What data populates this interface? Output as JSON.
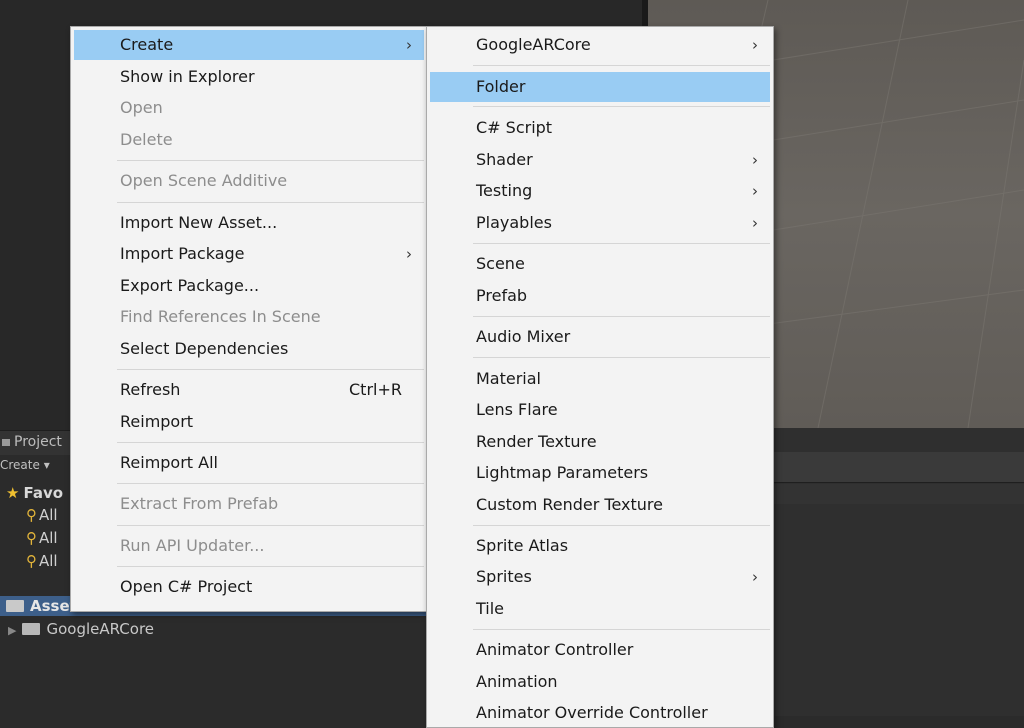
{
  "project_panel": {
    "tab_label": "Project",
    "create_label": "Create ▾",
    "favorites_label": "Favo",
    "search_items": [
      "All",
      "All",
      "All"
    ],
    "assets_label": "Assets",
    "tree_folder": "GoogleARCore"
  },
  "context_menu": {
    "items": [
      {
        "label": "Create",
        "state": "highlighted",
        "submenu": true
      },
      {
        "label": "Show in Explorer",
        "state": "enabled"
      },
      {
        "label": "Open",
        "state": "disabled"
      },
      {
        "label": "Delete",
        "state": "disabled"
      },
      {
        "label": "Open Scene Additive",
        "state": "disabled"
      },
      {
        "label": "Import New Asset...",
        "state": "enabled"
      },
      {
        "label": "Import Package",
        "state": "enabled",
        "submenu": true
      },
      {
        "label": "Export Package...",
        "state": "enabled"
      },
      {
        "label": "Find References In Scene",
        "state": "disabled"
      },
      {
        "label": "Select Dependencies",
        "state": "enabled"
      },
      {
        "label": "Refresh",
        "state": "enabled",
        "shortcut": "Ctrl+R"
      },
      {
        "label": "Reimport",
        "state": "enabled"
      },
      {
        "label": "Reimport All",
        "state": "enabled"
      },
      {
        "label": "Extract From Prefab",
        "state": "disabled"
      },
      {
        "label": "Run API Updater...",
        "state": "disabled"
      },
      {
        "label": "Open C# Project",
        "state": "enabled"
      }
    ]
  },
  "create_submenu": {
    "items": [
      {
        "label": "GoogleARCore",
        "submenu": true
      },
      {
        "label": "Folder",
        "state": "highlighted"
      },
      {
        "label": "C# Script"
      },
      {
        "label": "Shader",
        "submenu": true
      },
      {
        "label": "Testing",
        "submenu": true
      },
      {
        "label": "Playables",
        "submenu": true
      },
      {
        "label": "Scene"
      },
      {
        "label": "Prefab"
      },
      {
        "label": "Audio Mixer"
      },
      {
        "label": "Material"
      },
      {
        "label": "Lens Flare"
      },
      {
        "label": "Render Texture"
      },
      {
        "label": "Lightmap Parameters"
      },
      {
        "label": "Custom Render Texture"
      },
      {
        "label": "Sprite Atlas"
      },
      {
        "label": "Sprites",
        "submenu": true
      },
      {
        "label": "Tile"
      },
      {
        "label": "Animator Controller"
      },
      {
        "label": "Animation"
      },
      {
        "label": "Animator Override Controller"
      }
    ]
  },
  "icons": {
    "submenu_arrow": "chevron-right-icon",
    "folder": "folder-icon",
    "search": "search-icon",
    "favorite": "star-icon"
  },
  "colors": {
    "highlight": "#99ccf3",
    "menu_bg": "#f3f3f3",
    "disabled_text": "#8d8d8d",
    "selection_blue": "#3d5f8a"
  }
}
